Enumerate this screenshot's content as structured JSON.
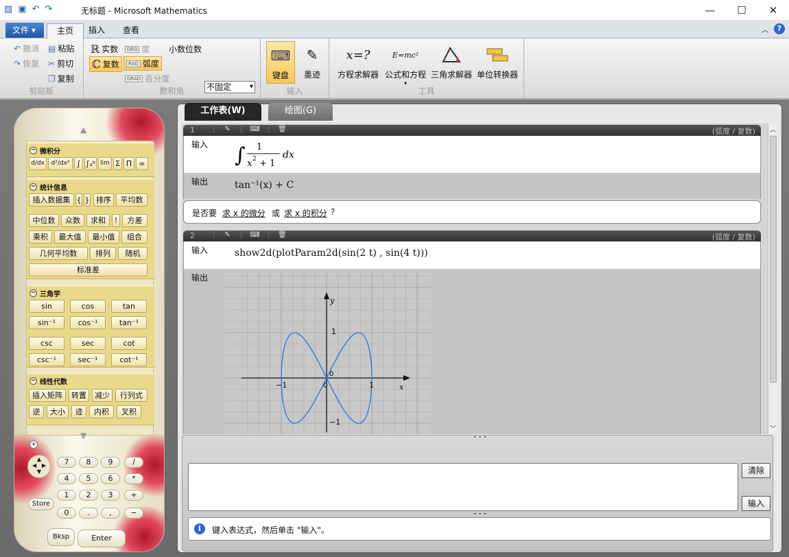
{
  "window": {
    "title": "无标题 - Microsoft Mathematics",
    "minimize": "—",
    "maximize": "☐",
    "close": "✕"
  },
  "ribbon_tabs": {
    "file": "文件",
    "home": "主页",
    "insert": "插入",
    "view": "查看"
  },
  "clipboard": {
    "undo": "撤消",
    "redo": "恢复",
    "paste": "粘贴",
    "cut": "剪切",
    "copy": "复制",
    "group": "剪贴板"
  },
  "numbers": {
    "real": "实数",
    "complex": "复数",
    "deg": "度",
    "rad": "弧度",
    "grad": "百分度",
    "decimals_label": "小数位数",
    "decimals_value": "不固定",
    "group": "数和角",
    "deg_tag": "DEG",
    "rad_tag": "RAD",
    "grad_tag": "GRAD"
  },
  "input_group": {
    "keyboard": "键盘",
    "ink": "墨迹",
    "group": "输入"
  },
  "tools": {
    "eq_solver": "方程求解器",
    "formulas": "公式和方程",
    "triangle": "三角求解器",
    "units": "单位转换器",
    "group": "工具",
    "eq_icon": "x=?",
    "formula_icon": "E=mc²"
  },
  "calc": {
    "calculus": {
      "title": "微积分",
      "buttons": [
        "d/dx",
        "d²/dx²",
        "∫",
        "∫ₐᵇ",
        "lim",
        "Σ",
        "Π",
        "∞"
      ]
    },
    "stats": {
      "title": "统计信息",
      "buttons": [
        "插入数据集",
        "{",
        "}",
        "排序",
        "平均数",
        "中位数",
        "众数",
        "求和",
        "!",
        "方差",
        "乘积",
        "最大值",
        "最小值",
        "组合",
        "几何平均数",
        "排列",
        "随机",
        "标准差"
      ]
    },
    "trig": {
      "title": "三角学",
      "buttons": [
        "sin",
        "cos",
        "tan",
        "sin⁻¹",
        "cos⁻¹",
        "tan⁻¹",
        "csc",
        "sec",
        "cot",
        "csc⁻¹",
        "sec⁻¹",
        "cot⁻¹"
      ]
    },
    "linalg": {
      "title": "线性代数",
      "buttons": [
        "插入矩阵",
        "转置",
        "减少",
        "行列式",
        "逆",
        "大小",
        "迹",
        "内积",
        "叉积"
      ]
    },
    "keys": [
      "7",
      "8",
      "9",
      "/",
      "4",
      "5",
      "6",
      "*",
      "1",
      "2",
      "3",
      "+",
      "0",
      ".",
      ",",
      "−"
    ],
    "store": "Store",
    "bksp": "Bksp",
    "enter": "Enter"
  },
  "worksheet": {
    "tab_ws": "工作表(W)",
    "tab_graph": "绘图(G)",
    "entry1": {
      "num": "1",
      "mode": "(弧度 / 复数)",
      "in_label": "输入",
      "out_label": "输出",
      "output": "tan⁻¹(x) + C"
    },
    "suggestion": {
      "prefix": "是否要",
      "link1": "求 x 的微分",
      "mid": "或",
      "link2": "求 x 的积分",
      "suffix": "?"
    },
    "entry2": {
      "num": "2",
      "mode": "(弧度 / 复数)",
      "in_label": "输入",
      "out_label": "输出",
      "input": "show2d(plotParam2d(sin(2 t) , sin(4 t)))"
    }
  },
  "plot": {
    "x_label": "x",
    "y_label": "y",
    "ticks_x": [
      "−1",
      "1"
    ],
    "ticks_y": [
      "1",
      "−1"
    ],
    "origin": "0",
    "curve_color": "#3377dd"
  },
  "input_panel": {
    "clear": "清除",
    "enter": "输入",
    "hint": "键入表达式，然后单击 \"输入\"。"
  }
}
